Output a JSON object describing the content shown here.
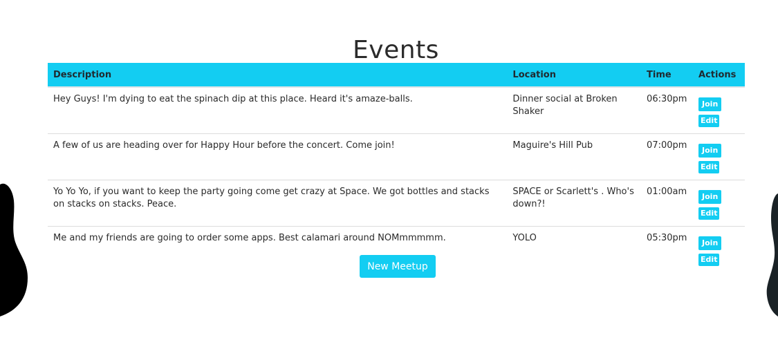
{
  "page": {
    "title": "Events"
  },
  "table": {
    "headers": {
      "description": "Description",
      "location": "Location",
      "time": "Time",
      "actions": "Actions"
    },
    "rows": [
      {
        "description": "Hey Guys! I'm dying to eat the spinach dip at this place. Heard it's amaze-balls.",
        "location": "Dinner social at Broken Shaker",
        "time": "06:30pm",
        "join_label": "Join",
        "edit_label": "Edit"
      },
      {
        "description": "A few of us are heading over for Happy Hour before the concert. Come join!",
        "location": "Maguire's Hill Pub",
        "time": "07:00pm",
        "join_label": "Join",
        "edit_label": "Edit"
      },
      {
        "description": "Yo Yo Yo, if you want to keep the party going come get crazy at Space. We got bottles and stacks on stacks on stacks. Peace.",
        "location": "SPACE or Scarlett's . Who's down?!",
        "time": "01:00am",
        "join_label": "Join",
        "edit_label": "Edit"
      },
      {
        "description": "Me and my friends are going to order some apps. Best calamari around NOMmmmmm.",
        "location": "YOLO",
        "time": "05:30pm",
        "join_label": "Join",
        "edit_label": "Edit"
      }
    ]
  },
  "new_meetup_label": "New Meetup",
  "colors": {
    "accent": "#13cdf2",
    "title": "#2b2b2b",
    "decor_left": "#000000",
    "decor_right": "#1a2226"
  }
}
